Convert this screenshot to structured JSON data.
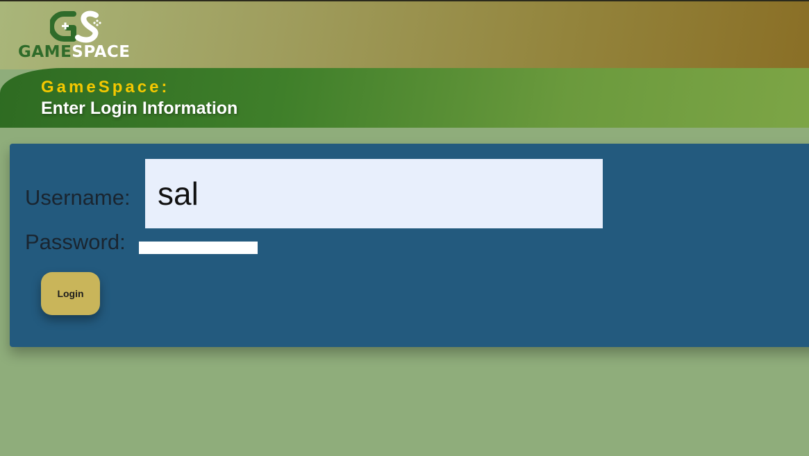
{
  "header": {
    "logo": {
      "word_left": "GAME",
      "word_right": "SPACE"
    }
  },
  "banner": {
    "subtitle": "GameSpace:",
    "title": "Enter Login Information"
  },
  "form": {
    "username_label": "Username:",
    "username_value": "sal",
    "password_label": "Password:",
    "password_value": "",
    "login_label": "Login"
  },
  "colors": {
    "panel": "#235a7e",
    "button": "#c9b55a",
    "accent_yellow": "#f5c800",
    "logo_green": "#2f6b2a",
    "page_bg": "#8fad7b"
  },
  "icons": {
    "logo_mark": "gamepad-gs-icon"
  }
}
